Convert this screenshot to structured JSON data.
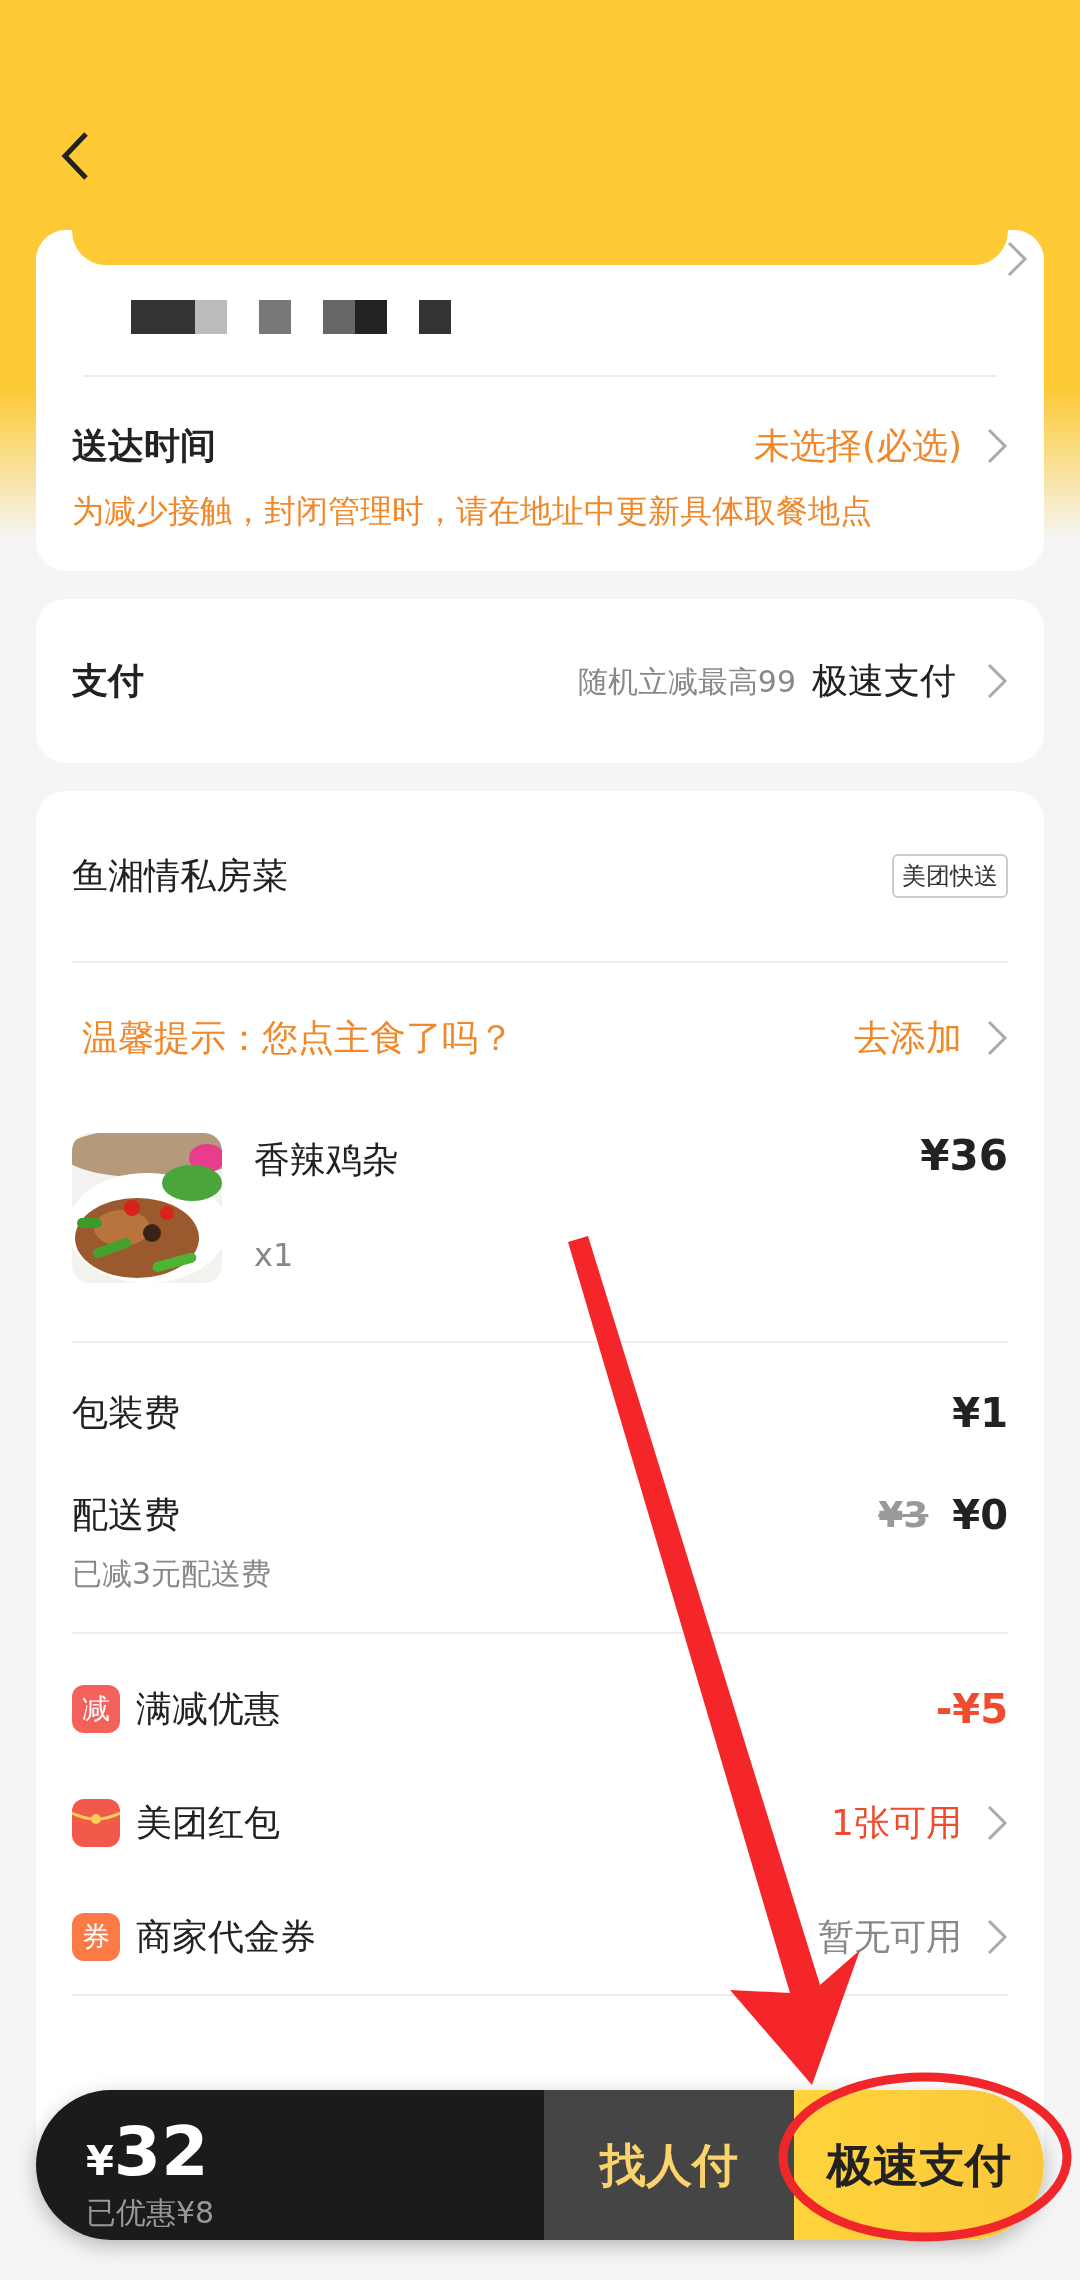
{
  "delivery_time": {
    "label": "送达时间",
    "value": "未选择(必选)",
    "notice": "为减少接触，封闭管理时，请在地址中更新具体取餐地点"
  },
  "payment": {
    "label": "支付",
    "promo": "随机立减最高99",
    "method": "极速支付"
  },
  "order": {
    "shop": "鱼湘情私房菜",
    "badge": "美团快送",
    "tip": "温馨提示：您点主食了吗？",
    "tip_action": "去添加",
    "items": [
      {
        "name": "香辣鸡杂",
        "quantity": "x1",
        "price": "¥36"
      }
    ],
    "fees": [
      {
        "label": "包装费",
        "price": "¥1"
      },
      {
        "label": "配送费",
        "original_price": "¥3",
        "price": "¥0",
        "note": "已减3元配送费"
      }
    ],
    "discounts": [
      {
        "kind": "reduction",
        "icon_text": "减",
        "label": "满减优惠",
        "value": "-¥5",
        "highlight": true,
        "chevron": false
      },
      {
        "kind": "red_packet",
        "label": "美团红包",
        "value": "1张可用",
        "highlight": true,
        "chevron": true
      },
      {
        "kind": "voucher",
        "icon_text": "券",
        "label": "商家代金券",
        "value": "暂无可用",
        "highlight": false,
        "chevron": true
      }
    ]
  },
  "bottom_bar": {
    "currency": "¥",
    "total": "32",
    "saved": "已优惠¥8",
    "buttons": [
      {
        "label": "找人付",
        "primary": false
      },
      {
        "label": "极速支付",
        "primary": true
      }
    ]
  }
}
